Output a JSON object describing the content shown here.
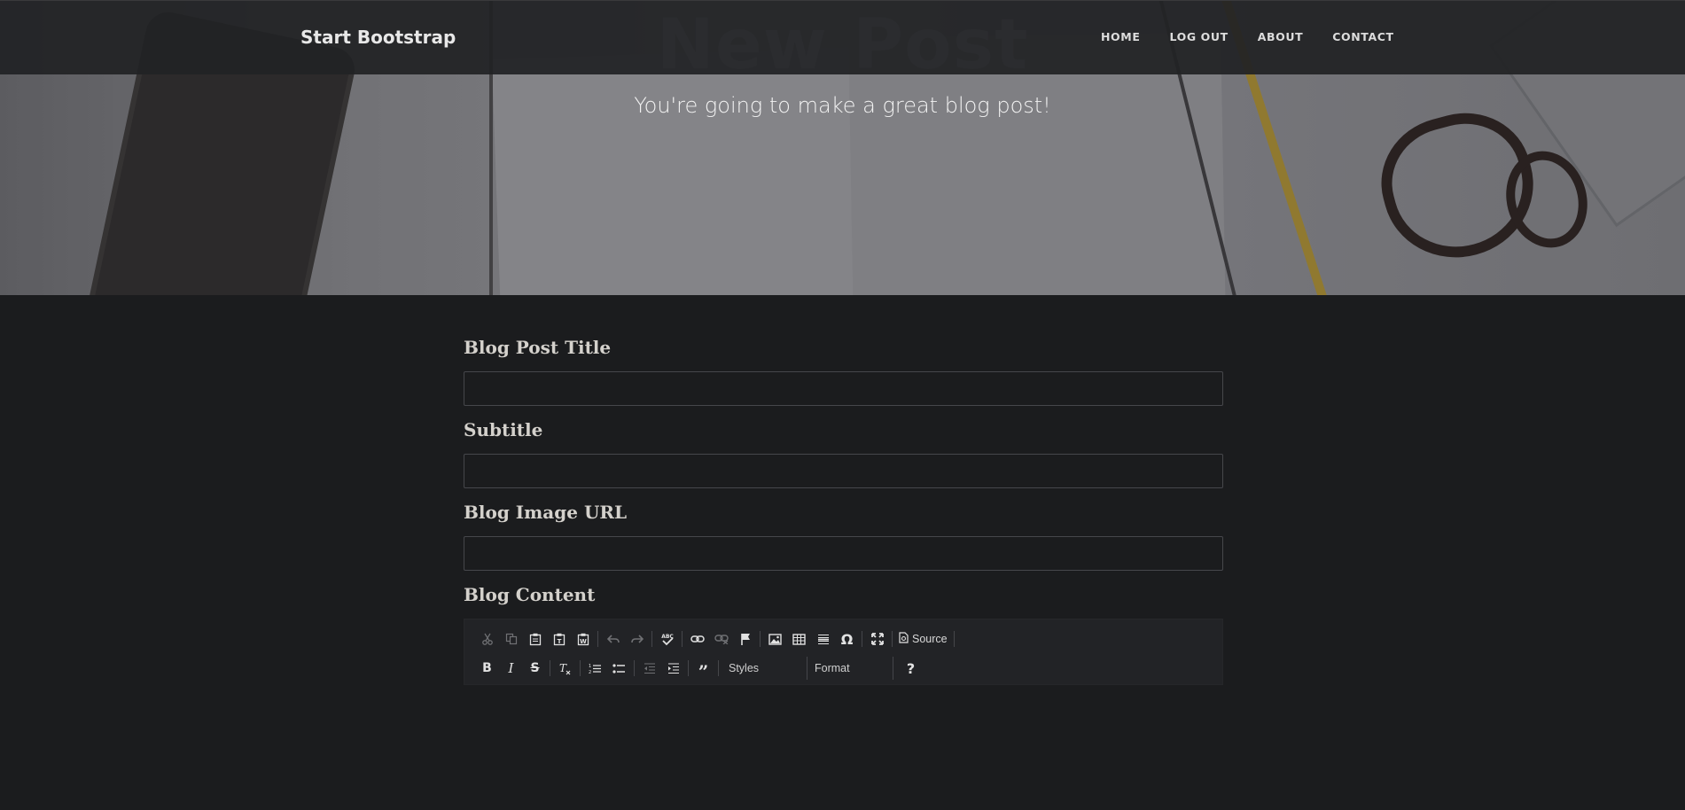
{
  "navbar": {
    "brand": "Start Bootstrap",
    "links": [
      "HOME",
      "LOG OUT",
      "ABOUT",
      "CONTACT"
    ]
  },
  "hero": {
    "title": "New Post",
    "subtitle": "You're going to make a great blog post!"
  },
  "form": {
    "title_label": "Blog Post Title",
    "title_value": "",
    "subtitle_label": "Subtitle",
    "subtitle_value": "",
    "image_label": "Blog Image URL",
    "image_value": "",
    "content_label": "Blog Content"
  },
  "editor": {
    "row1": [
      "cut-icon",
      "copy-icon",
      "paste-icon",
      "paste-text-icon",
      "paste-word-icon",
      "undo-icon",
      "redo-icon",
      "spellcheck-icon",
      "link-icon",
      "unlink-icon",
      "anchor-icon",
      "image-icon",
      "table-icon",
      "horizontal-rule-icon",
      "special-char-icon",
      "maximize-icon",
      "source-icon"
    ],
    "source_label": "Source",
    "row2": [
      "bold-icon",
      "italic-icon",
      "strike-icon",
      "remove-format-icon",
      "numbered-list-icon",
      "bulleted-list-icon",
      "outdent-icon",
      "indent-icon",
      "blockquote-icon",
      "help-icon"
    ],
    "styles_label": "Styles",
    "format_label": "Format",
    "help_label": "?"
  },
  "colors": {
    "page_bg": "#1b1c1e",
    "navbar_bg": "#212225",
    "label": "#d4d1cc"
  }
}
